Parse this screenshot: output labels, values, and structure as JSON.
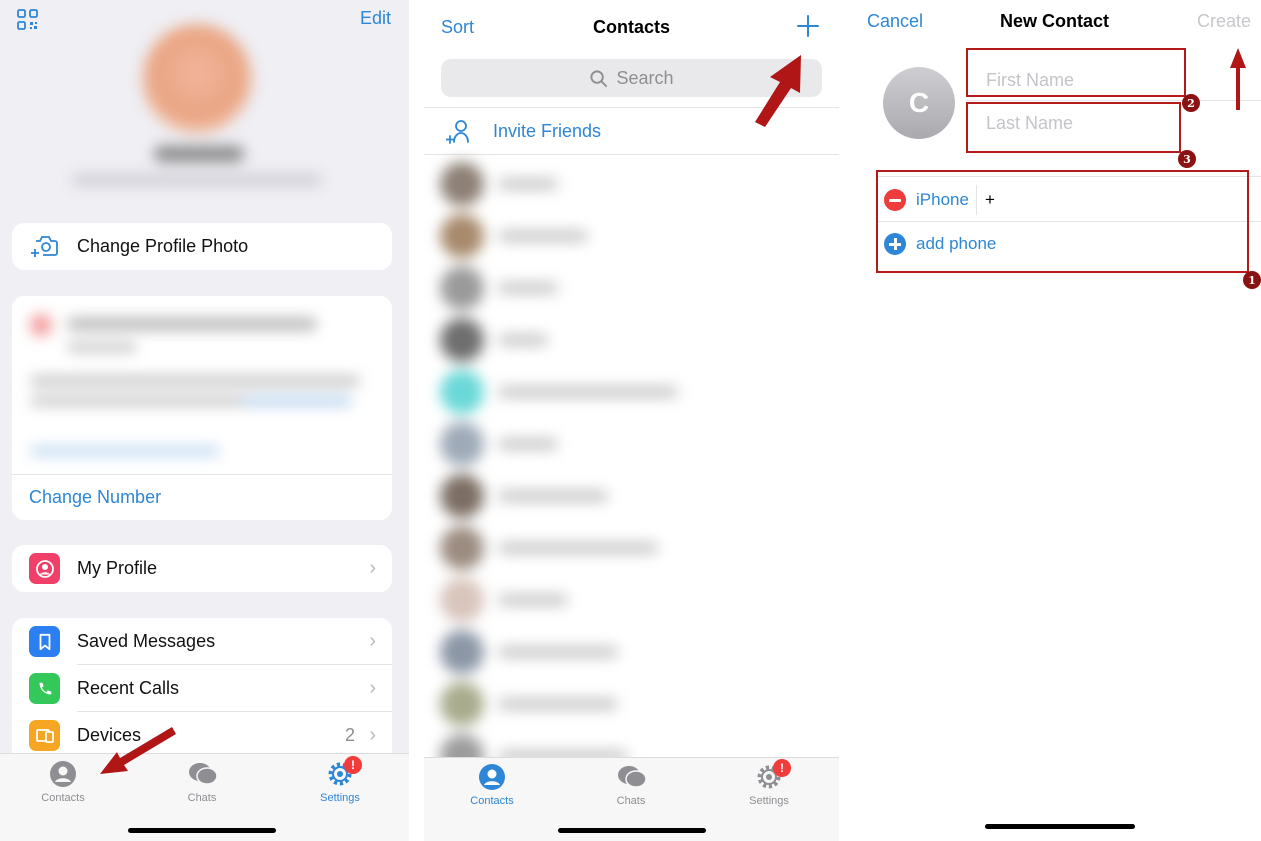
{
  "settings_screen": {
    "edit_label": "Edit",
    "change_photo_label": "Change Profile Photo",
    "change_number_label": "Change Number",
    "menu": [
      {
        "label": "My Profile",
        "icon": "person-icon",
        "color": "#f0406a"
      },
      {
        "label": "Saved Messages",
        "icon": "bookmark-icon",
        "color": "#2b7ff0"
      },
      {
        "label": "Recent Calls",
        "icon": "phone-icon",
        "color": "#34c759"
      },
      {
        "label": "Devices",
        "icon": "devices-icon",
        "color": "#f6a623",
        "count": "2"
      }
    ],
    "tabs": [
      {
        "label": "Contacts",
        "icon": "person-circle-icon"
      },
      {
        "label": "Chats",
        "icon": "chat-bubbles-icon"
      },
      {
        "label": "Settings",
        "icon": "gear-icon",
        "badge": "!"
      }
    ]
  },
  "contacts_screen": {
    "sort_label": "Sort",
    "title": "Contacts",
    "search_placeholder": "Search",
    "invite_label": "Invite Friends",
    "tabs": [
      {
        "label": "Contacts"
      },
      {
        "label": "Chats"
      },
      {
        "label": "Settings",
        "badge": "!"
      }
    ]
  },
  "new_contact_screen": {
    "cancel_label": "Cancel",
    "title": "New Contact",
    "create_label": "Create",
    "avatar_initial": "C",
    "first_name_placeholder": "First Name",
    "last_name_placeholder": "Last Name",
    "phone_type": "iPhone",
    "phone_value": "+",
    "add_phone_label": "add phone",
    "step_numbers": [
      "1",
      "2",
      "3"
    ]
  },
  "colors": {
    "accent": "#2e86d6",
    "annotation": "#b31b1b",
    "badge": "#f23b3b"
  }
}
